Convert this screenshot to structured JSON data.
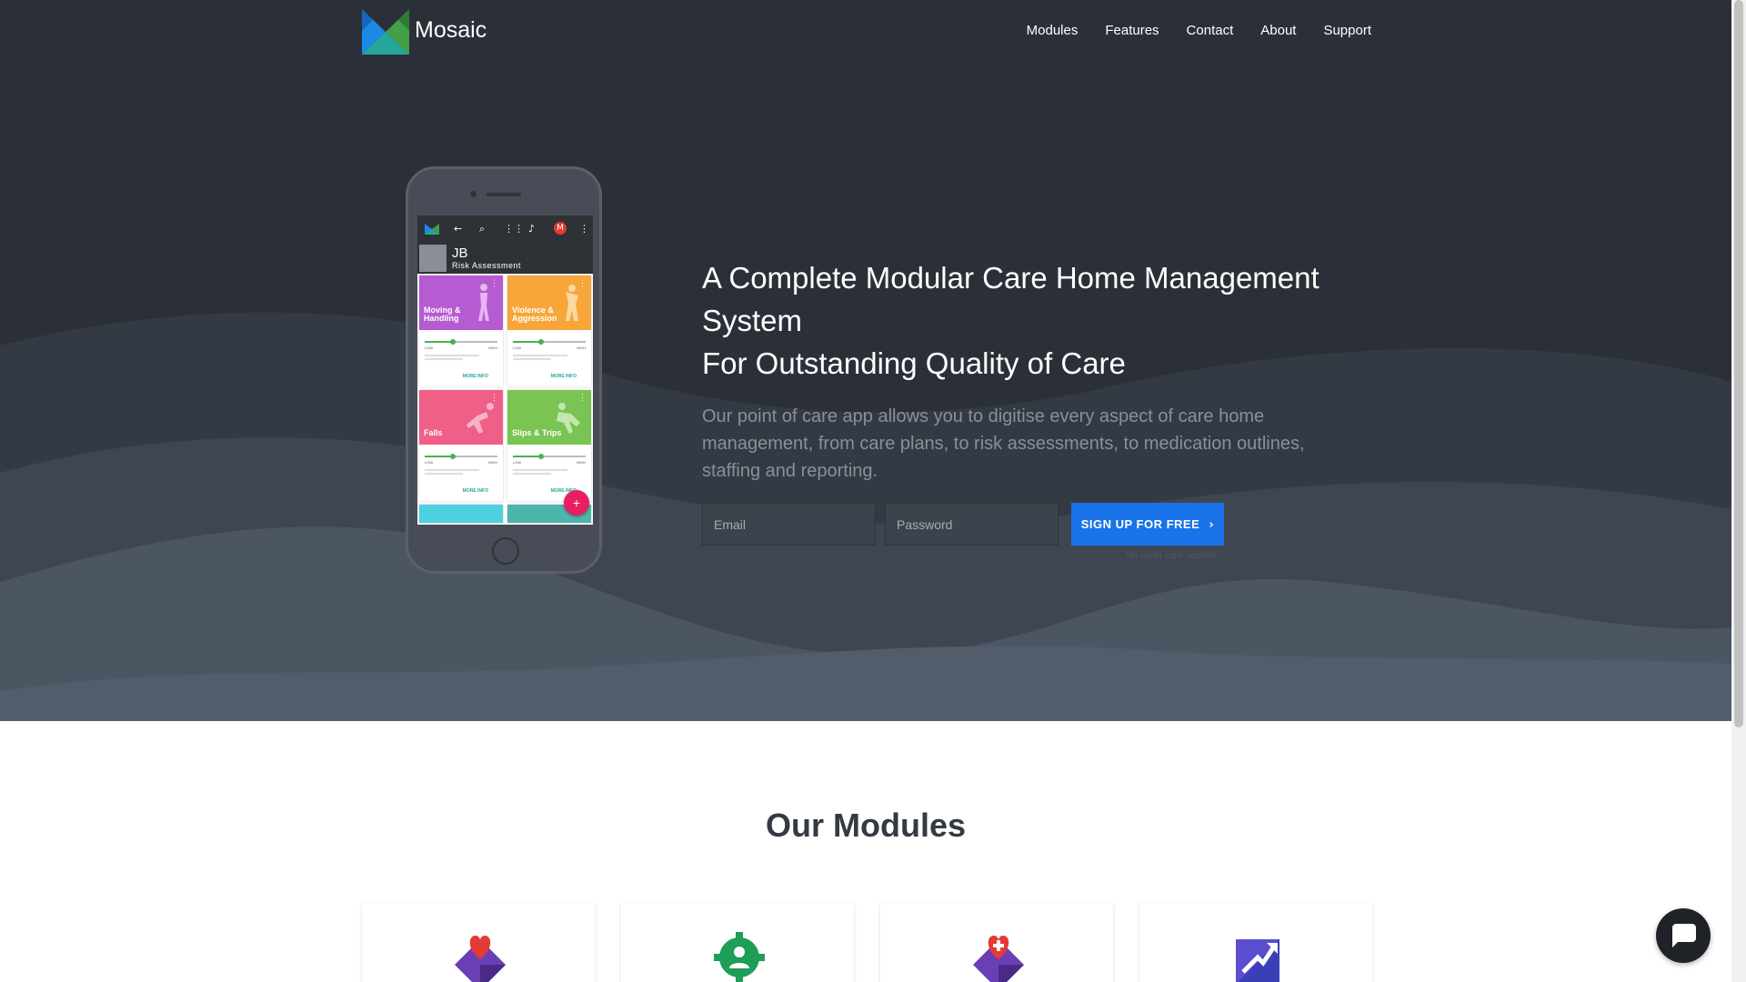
{
  "nav": {
    "brand": "Mosaic",
    "links": [
      "Modules",
      "Features",
      "Contact",
      "About",
      "Support"
    ]
  },
  "phone": {
    "user_initials": "JB",
    "screen_title": "Risk Assessment",
    "tiles": [
      {
        "title": "Moving & Handling",
        "color": "#b65bd1"
      },
      {
        "title": "Violence & Aggression",
        "color": "#f7a63a"
      },
      {
        "title": "Falls",
        "color": "#ef5f88"
      },
      {
        "title": "Slips & Trips",
        "color": "#79c452"
      }
    ],
    "scale_low": "LOW",
    "scale_high": "HIGH",
    "more_info": "MORE INFO",
    "fab": "+"
  },
  "hero": {
    "headline_line1": "A Complete Modular Care Home Management",
    "headline_line2": "System",
    "headline_line3": "For Outstanding Quality of Care",
    "lead": "Our point of care app allows you to digitise every aspect of care home management, from care plans, to risk assessments, to medication outlines, staffing and reporting.",
    "email_placeholder": "Email",
    "password_placeholder": "Password",
    "signup_label": "SIGN UP FOR FREE",
    "signup_icon": "chevron-right",
    "no_card": "No credit card needed"
  },
  "modules": {
    "title": "Our Modules",
    "icons": [
      "heart-diamond-icon",
      "gear-person-icon",
      "medical-cross-diamond-icon",
      "trend-arrow-icon"
    ]
  },
  "colors": {
    "hero_bg": "#2b3038",
    "accent": "#1a73e8",
    "fab": "#e91e63"
  }
}
